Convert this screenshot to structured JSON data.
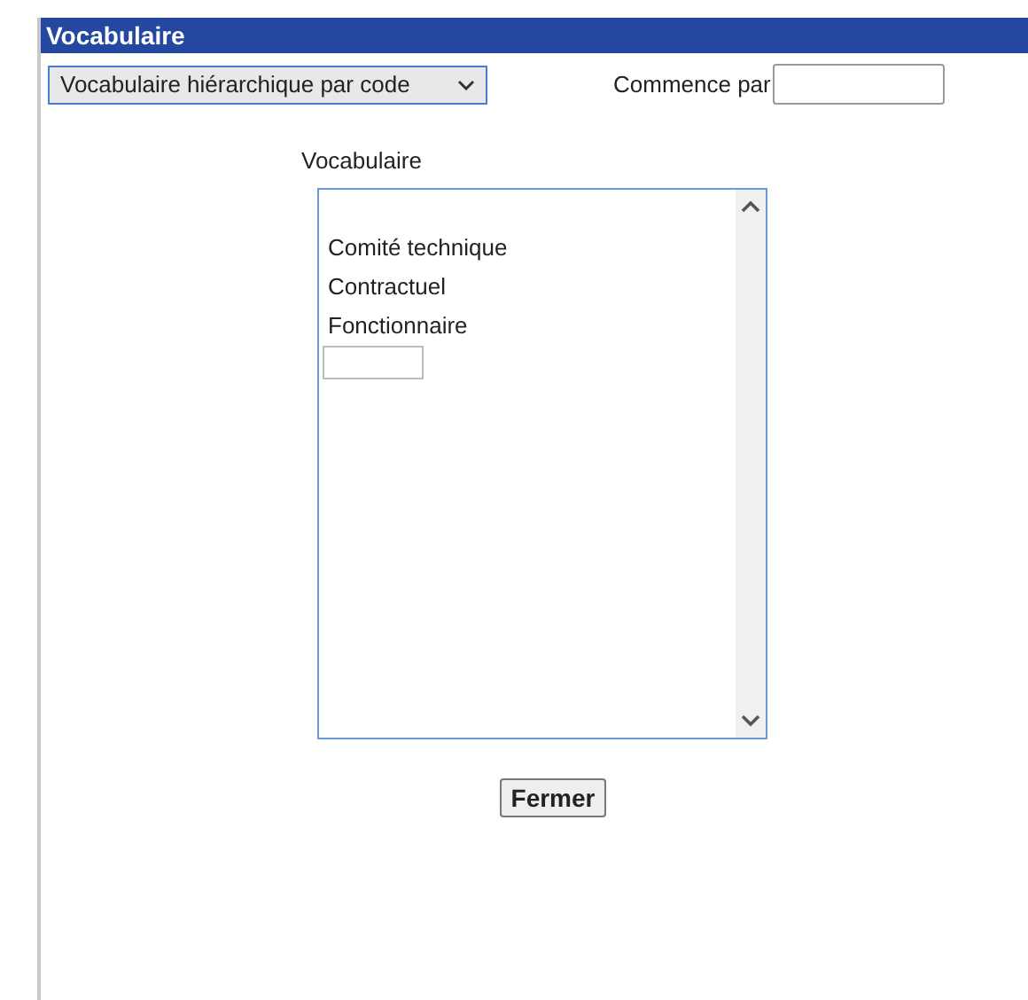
{
  "window": {
    "title": "Vocabulaire"
  },
  "vocabulary_select": {
    "value": "Vocabulaire hiérarchique par code"
  },
  "starts_with": {
    "label": "Commence par"
  },
  "list": {
    "label": "Vocabulaire",
    "items": [
      {
        "label": "Comité technique"
      },
      {
        "label": "Contractuel"
      },
      {
        "label": "Fonctionnaire"
      }
    ]
  },
  "buttons": [
    "Fermer"
  ]
}
